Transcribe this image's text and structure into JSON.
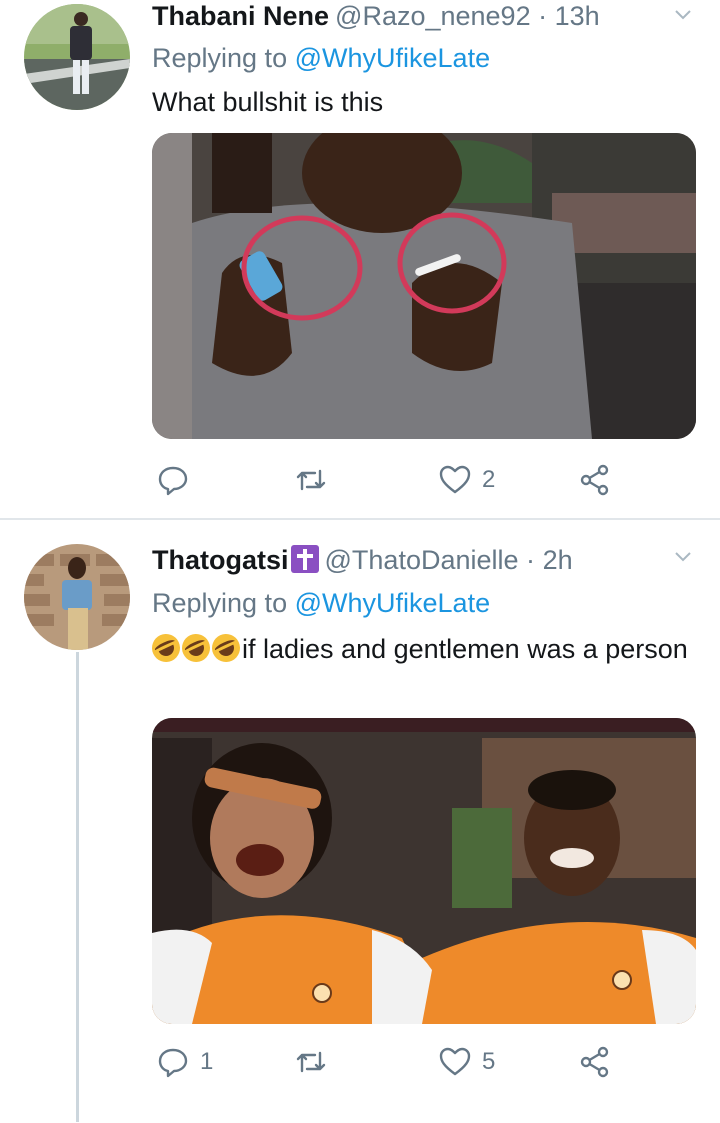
{
  "tweets": [
    {
      "name": "Thabani Nene",
      "handle": "@Razo_nene92",
      "separator": "·",
      "time": "13h",
      "replying_prefix": "Replying to",
      "replying_to": "@WhyUfikeLate",
      "text": "What bullshit is this",
      "counts": {
        "reply": "",
        "retweet": "",
        "like": "2"
      }
    },
    {
      "name": "Thatogatsi",
      "handle": "@ThatoDanielle",
      "separator": "·",
      "time": "2h",
      "replying_prefix": "Replying to",
      "replying_to": "@WhyUfikeLate",
      "text": "if ladies and gentlemen was a person",
      "counts": {
        "reply": "1",
        "retweet": "",
        "like": "5"
      }
    }
  ],
  "colors": {
    "link": "#1b95e0",
    "secondary_text": "#657786",
    "divider": "#e1e6ea",
    "thread_line": "#ccd6dd"
  },
  "icons": [
    "chevron-down-icon",
    "reply-icon",
    "retweet-icon",
    "like-icon",
    "share-icon",
    "latin-cross-emoji",
    "rolling-laughing-emoji"
  ]
}
